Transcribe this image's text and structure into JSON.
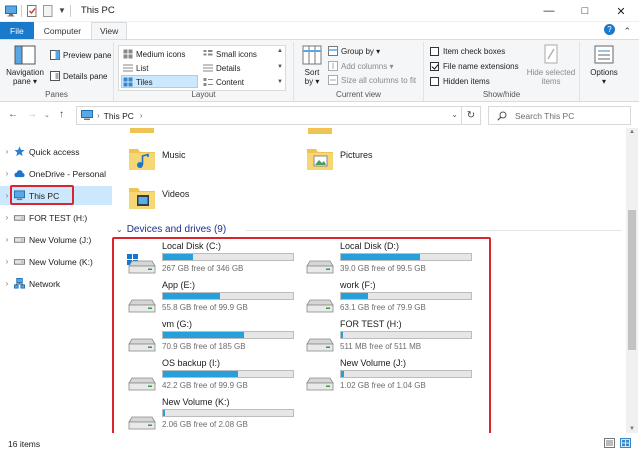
{
  "window": {
    "title": "This PC"
  },
  "ribbon_tabs": [
    "File",
    "Computer",
    "View"
  ],
  "ribbon": {
    "panes": {
      "navigation_pane": "Navigation",
      "navigation_pane2": "pane",
      "preview_pane": "Preview pane",
      "details_pane": "Details pane",
      "group_label": "Panes"
    },
    "layout": {
      "medium_icons": "Medium icons",
      "small_icons": "Small icons",
      "list": "List",
      "details": "Details",
      "tiles": "Tiles",
      "content": "Content",
      "group_label": "Layout"
    },
    "current_view": {
      "sort_by": "Sort",
      "sort_by2": "by",
      "group_by": "Group by",
      "add_columns": "Add columns",
      "size_all_columns": "Size all columns to fit",
      "group_label": "Current view"
    },
    "show_hide": {
      "item_check_boxes": "Item check boxes",
      "file_name_extensions": "File name extensions",
      "hidden_items": "Hidden items",
      "hide_selected": "Hide selected",
      "hide_selected2": "items",
      "group_label": "Show/hide"
    },
    "options": {
      "label": "Options"
    }
  },
  "address": {
    "path": "This PC",
    "search_placeholder": "Search This PC"
  },
  "nav": [
    {
      "label": "Quick access"
    },
    {
      "label": "OneDrive - Personal"
    },
    {
      "label": "This PC"
    },
    {
      "label": "FOR TEST (H:)"
    },
    {
      "label": "New Volume (J:)"
    },
    {
      "label": "New Volume (K:)"
    },
    {
      "label": "Network"
    }
  ],
  "folders": [
    {
      "label": "Music"
    },
    {
      "label": "Pictures"
    },
    {
      "label": "Videos"
    }
  ],
  "devices_header": "Devices and drives (9)",
  "drives": [
    {
      "name": "Local Disk (C:)",
      "free": "267 GB free of 346 GB",
      "used_fraction": 0.23,
      "system": true
    },
    {
      "name": "Local Disk (D:)",
      "free": "39.0 GB free of 99.5 GB",
      "used_fraction": 0.61
    },
    {
      "name": "App (E:)",
      "free": "55.8 GB free of 99.9 GB",
      "used_fraction": 0.44
    },
    {
      "name": "work (F:)",
      "free": "63.1 GB free of 79.9 GB",
      "used_fraction": 0.21
    },
    {
      "name": "vm (G:)",
      "free": "70.9 GB free of 185 GB",
      "used_fraction": 0.62
    },
    {
      "name": "FOR TEST (H:)",
      "free": "511 MB free of 511 MB",
      "used_fraction": 0.0
    },
    {
      "name": "OS backup (I:)",
      "free": "42.2 GB free of 99.9 GB",
      "used_fraction": 0.58
    },
    {
      "name": "New Volume (J:)",
      "free": "1.02 GB free of 1.04 GB",
      "used_fraction": 0.02
    },
    {
      "name": "New Volume (K:)",
      "free": "2.06 GB free of 2.08 GB",
      "used_fraction": 0.01
    }
  ],
  "status": {
    "count": "16 items"
  },
  "colors": {
    "accent": "#1979ca",
    "selection": "#cce8ff",
    "highlight_box": "#d9262c",
    "drive_bar": "#26a0da"
  }
}
